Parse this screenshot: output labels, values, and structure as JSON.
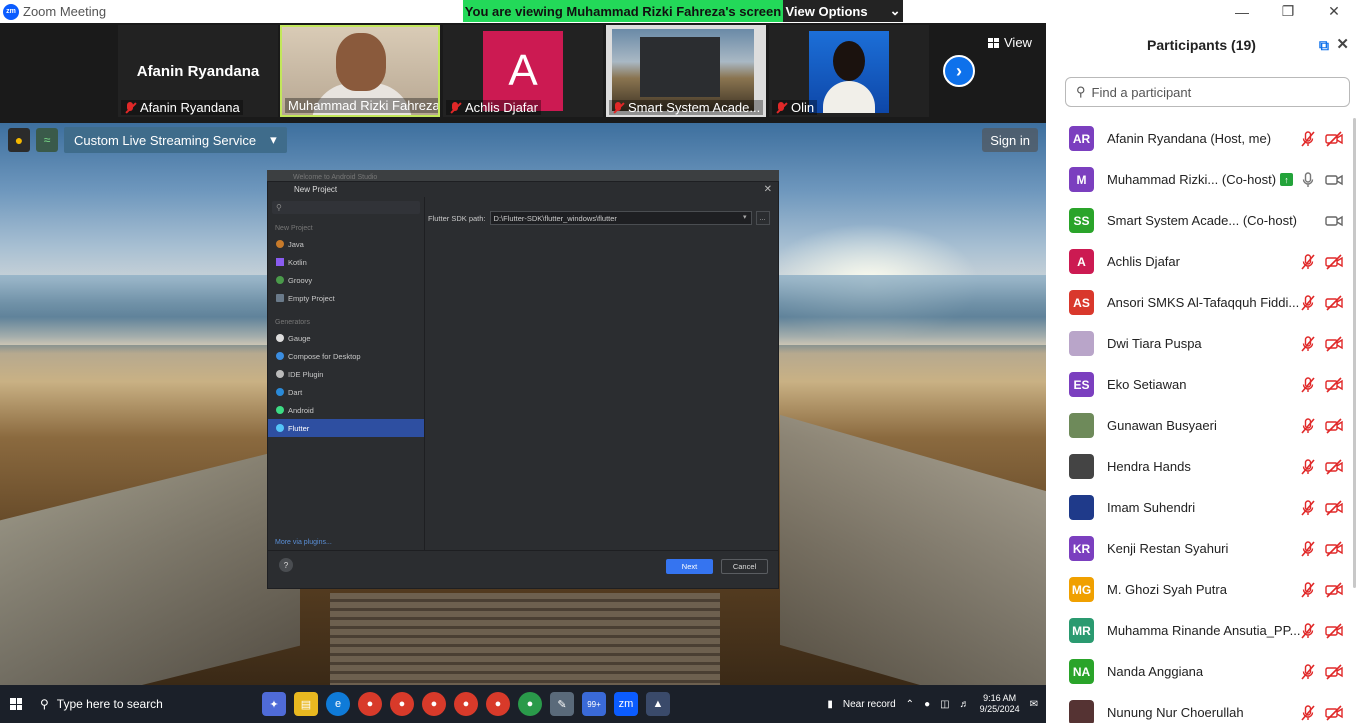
{
  "window": {
    "title": "Zoom Meeting",
    "logo": "zm"
  },
  "banner": {
    "message": "You are viewing Muhammad Rizki Fahreza's screen",
    "options_label": "View Options"
  },
  "strip": {
    "speaker_name": "Afanin Ryandana",
    "tiles": [
      {
        "name": "Afanin Ryandana",
        "muted": true
      },
      {
        "name": "Muhammad Rizki Fahreza",
        "muted": false
      },
      {
        "name": "Achlis Djafar",
        "muted": true,
        "initial": "A"
      },
      {
        "name": "Smart System Acade...",
        "muted": true
      },
      {
        "name": "Olin",
        "muted": true
      }
    ],
    "view_label": "View"
  },
  "shared_screen": {
    "stream_label": "Custom Live Streaming Service",
    "signin_label": "Sign in",
    "android_studio": {
      "behind_title": "Welcome to Android Studio",
      "title": "New Project",
      "sections": [
        {
          "label": "New Project",
          "items": [
            "Java",
            "Kotlin",
            "Groovy",
            "Empty Project"
          ]
        },
        {
          "label": "Generators",
          "items": [
            "Gauge",
            "Compose for Desktop",
            "IDE Plugin",
            "Dart",
            "Android",
            "Flutter"
          ]
        }
      ],
      "selected": "Flutter",
      "more_plugins": "More via plugins...",
      "sdk_label": "Flutter SDK path:",
      "sdk_value": "D:\\Flutter-SDK\\flutter_windows\\flutter",
      "browse_label": "...",
      "help_label": "?",
      "next_label": "Next",
      "cancel_label": "Cancel"
    }
  },
  "taskbar": {
    "search_placeholder": "Type here to search",
    "tray_label": "Near record",
    "time": "9:16 AM",
    "date": "9/25/2024",
    "badge": "99+"
  },
  "participants": {
    "title": "Participants (19)",
    "search_placeholder": "Find a participant",
    "list": [
      {
        "initials": "AR",
        "color": "#7b3fbf",
        "name": "Afanin Ryandana (Host, me)",
        "mic": "off",
        "cam": "off"
      },
      {
        "initials": "M",
        "color": "#7b3fbf",
        "name": "Muhammad Rizki... (Co-host)",
        "mic": "on",
        "cam": "on",
        "sharing": true
      },
      {
        "initials": "SS",
        "color": "#2aa42a",
        "name": "Smart System Acade...  (Co-host)",
        "mic": "none",
        "cam": "on"
      },
      {
        "initials": "A",
        "color": "#cc1a52",
        "name": "Achlis Djafar",
        "mic": "off",
        "cam": "off"
      },
      {
        "initials": "AS",
        "color": "#d9382c",
        "name": "Ansori SMKS Al-Tafaqquh Fiddi...",
        "mic": "off",
        "cam": "off"
      },
      {
        "initials": "",
        "color": "#b9a5c9",
        "name": "Dwi Tiara Puspa",
        "mic": "off",
        "cam": "off"
      },
      {
        "initials": "ES",
        "color": "#7b3fbf",
        "name": "Eko Setiawan",
        "mic": "off",
        "cam": "off"
      },
      {
        "initials": "",
        "color": "#6e8a5a",
        "name": "Gunawan Busyaeri",
        "mic": "off",
        "cam": "off"
      },
      {
        "initials": "",
        "color": "#444444",
        "name": "Hendra Hands",
        "mic": "off",
        "cam": "off"
      },
      {
        "initials": "",
        "color": "#1f3a8a",
        "name": "Imam Suhendri",
        "mic": "off",
        "cam": "off"
      },
      {
        "initials": "KR",
        "color": "#7b3fbf",
        "name": "Kenji Restan Syahuri",
        "mic": "off",
        "cam": "off"
      },
      {
        "initials": "MG",
        "color": "#f0a000",
        "name": "M. Ghozi Syah Putra",
        "mic": "off",
        "cam": "off"
      },
      {
        "initials": "MR",
        "color": "#2a9a70",
        "name": "Muhamma Rinande Ansutia_PP...",
        "mic": "off",
        "cam": "off"
      },
      {
        "initials": "NA",
        "color": "#2aa42a",
        "name": "Nanda  Anggiana",
        "mic": "off",
        "cam": "off"
      },
      {
        "initials": "",
        "color": "#553333",
        "name": "Nunung Nur Choerullah",
        "mic": "off",
        "cam": "off"
      }
    ]
  }
}
